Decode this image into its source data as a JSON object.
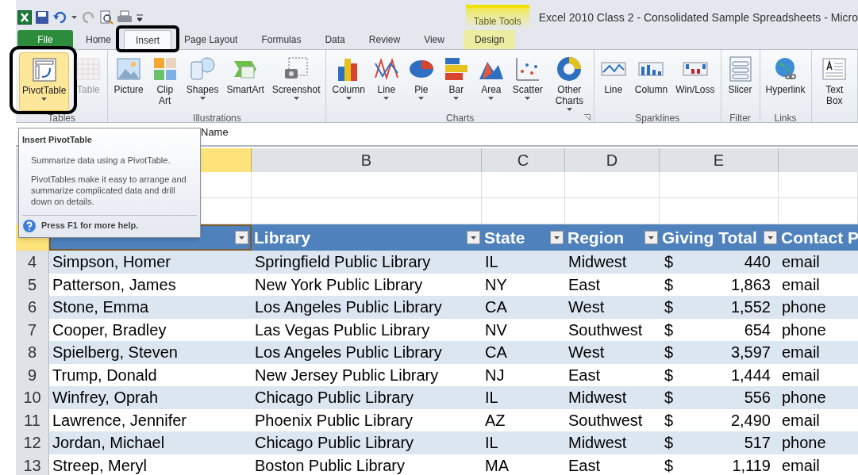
{
  "window": {
    "title": "Excel 2010 Class 2 - Consolidated Sample Spreadsheets - Micro",
    "contextual_label": "Table Tools"
  },
  "tabs": [
    {
      "label": "File",
      "kind": "file",
      "selected": false,
      "highlighted": false
    },
    {
      "label": "Home",
      "kind": "tab",
      "selected": false,
      "highlighted": false
    },
    {
      "label": "Insert",
      "kind": "tab",
      "selected": true,
      "highlighted": true
    },
    {
      "label": "Page Layout",
      "kind": "tab",
      "selected": false,
      "highlighted": false
    },
    {
      "label": "Formulas",
      "kind": "tab",
      "selected": false,
      "highlighted": false
    },
    {
      "label": "Data",
      "kind": "tab",
      "selected": false,
      "highlighted": false
    },
    {
      "label": "Review",
      "kind": "tab",
      "selected": false,
      "highlighted": false
    },
    {
      "label": "View",
      "kind": "tab",
      "selected": false,
      "highlighted": false
    },
    {
      "label": "Design",
      "kind": "contextual",
      "selected": false,
      "highlighted": false
    }
  ],
  "ribbon_groups": [
    {
      "label": "Tables",
      "buttons": [
        {
          "label": "PivotTable",
          "caret": true,
          "disabled": false,
          "highlighted": true
        },
        {
          "label": "Table",
          "caret": false,
          "disabled": true,
          "highlighted": false
        }
      ]
    },
    {
      "label": "Illustrations",
      "buttons": [
        {
          "label": "Picture",
          "caret": false,
          "disabled": false,
          "highlighted": false
        },
        {
          "label": "Clip Art",
          "caret": false,
          "disabled": false,
          "highlighted": false
        },
        {
          "label": "Shapes",
          "caret": true,
          "disabled": false,
          "highlighted": false
        },
        {
          "label": "SmartArt",
          "caret": false,
          "disabled": false,
          "highlighted": false
        },
        {
          "label": "Screenshot",
          "caret": true,
          "disabled": false,
          "highlighted": false
        }
      ]
    },
    {
      "label": "Charts",
      "launcher": true,
      "buttons": [
        {
          "label": "Column",
          "caret": true,
          "disabled": false,
          "highlighted": false
        },
        {
          "label": "Line",
          "caret": true,
          "disabled": false,
          "highlighted": false
        },
        {
          "label": "Pie",
          "caret": true,
          "disabled": false,
          "highlighted": false
        },
        {
          "label": "Bar",
          "caret": true,
          "disabled": false,
          "highlighted": false
        },
        {
          "label": "Area",
          "caret": true,
          "disabled": false,
          "highlighted": false
        },
        {
          "label": "Scatter",
          "caret": true,
          "disabled": false,
          "highlighted": false
        },
        {
          "label": "Other Charts",
          "caret": true,
          "disabled": false,
          "highlighted": false
        }
      ]
    },
    {
      "label": "Sparklines",
      "buttons": [
        {
          "label": "Line",
          "caret": false,
          "disabled": false,
          "highlighted": false
        },
        {
          "label": "Column",
          "caret": false,
          "disabled": false,
          "highlighted": false
        },
        {
          "label": "Win/Loss",
          "caret": false,
          "disabled": false,
          "highlighted": false
        }
      ]
    },
    {
      "label": "Filter",
      "buttons": [
        {
          "label": "Slicer",
          "caret": false,
          "disabled": false,
          "highlighted": false
        }
      ]
    },
    {
      "label": "Links",
      "buttons": [
        {
          "label": "Hyperlink",
          "caret": false,
          "disabled": false,
          "highlighted": false
        }
      ]
    },
    {
      "buttons": [
        {
          "label": "Text Box",
          "caret": false,
          "disabled": false,
          "highlighted": false
        }
      ]
    }
  ],
  "formula_bar": {
    "value": "Name"
  },
  "tooltip": {
    "title": "Insert PivotTable",
    "lines": [
      "Summarize data using a PivotTable.",
      "PivotTables make it easy to arrange and summarize complicated data and drill down on details."
    ],
    "help": "Press F1 for more help."
  },
  "column_headers": [
    {
      "label": "B"
    },
    {
      "label": "C"
    },
    {
      "label": "D"
    },
    {
      "label": "E"
    }
  ],
  "table": {
    "columns": [
      "",
      "Library",
      "State",
      "Region",
      "Giving Total",
      "Contact P"
    ],
    "rows": [
      {
        "row": "4",
        "cells": [
          "Simpson, Homer",
          "Springfield Public Library",
          "IL",
          "Midwest",
          {
            "symbol": "$",
            "amount": "440"
          },
          "email"
        ]
      },
      {
        "row": "5",
        "cells": [
          "Patterson, James",
          "New York Public Library",
          "NY",
          "East",
          {
            "symbol": "$",
            "amount": "1,863"
          },
          "email"
        ]
      },
      {
        "row": "6",
        "cells": [
          "Stone, Emma",
          "Los Angeles Public Library",
          "CA",
          "West",
          {
            "symbol": "$",
            "amount": "1,552"
          },
          "phone"
        ]
      },
      {
        "row": "7",
        "cells": [
          "Cooper, Bradley",
          "Las Vegas Public Library",
          "NV",
          "Southwest",
          {
            "symbol": "$",
            "amount": "654"
          },
          "phone"
        ]
      },
      {
        "row": "8",
        "cells": [
          "Spielberg, Steven",
          "Los Angeles Public Library",
          "CA",
          "West",
          {
            "symbol": "$",
            "amount": "3,597"
          },
          "email"
        ]
      },
      {
        "row": "9",
        "cells": [
          "Trump, Donald",
          "New Jersey Public Library",
          "NJ",
          "East",
          {
            "symbol": "$",
            "amount": "1,444"
          },
          "email"
        ]
      },
      {
        "row": "10",
        "cells": [
          "Winfrey, Oprah",
          "Chicago Public Library",
          "IL",
          "Midwest",
          {
            "symbol": "$",
            "amount": "556"
          },
          "phone"
        ]
      },
      {
        "row": "11",
        "cells": [
          "Lawrence, Jennifer",
          "Phoenix Public Library",
          "AZ",
          "Southwest",
          {
            "symbol": "$",
            "amount": "2,490"
          },
          "email"
        ]
      },
      {
        "row": "12",
        "cells": [
          "Jordan, Michael",
          "Chicago Public Library",
          "IL",
          "Midwest",
          {
            "symbol": "$",
            "amount": "517"
          },
          "phone"
        ]
      },
      {
        "row": "13",
        "cells": [
          "Streep, Meryl",
          "Boston Public Library",
          "MA",
          "East",
          {
            "symbol": "$",
            "amount": "1,119"
          },
          "email"
        ]
      }
    ]
  }
}
